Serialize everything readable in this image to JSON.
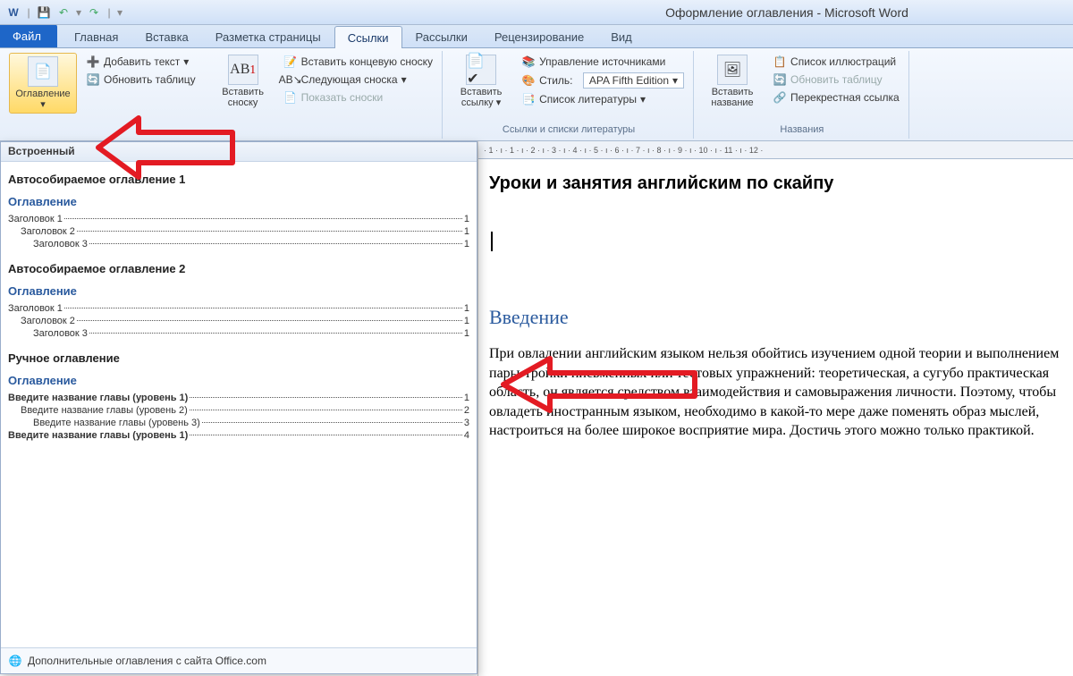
{
  "window": {
    "title": "Оформление оглавления - Microsoft Word"
  },
  "qat": {
    "save": "💾",
    "undo": "↶",
    "redo": "↷"
  },
  "tabs": {
    "file": "Файл",
    "home": "Главная",
    "insert": "Вставка",
    "layout": "Разметка страницы",
    "references": "Ссылки",
    "mailings": "Рассылки",
    "review": "Рецензирование",
    "view": "Вид"
  },
  "ribbon": {
    "toc": {
      "label": "Оглавление",
      "drop": "▾"
    },
    "add_text": "Добавить текст",
    "update_table": "Обновить таблицу",
    "insert_footnote": "Вставить сноску",
    "ab": "AB",
    "insert_endnote": "Вставить концевую сноску",
    "next_footnote": "Следующая сноска",
    "show_footnotes": "Показать сноски",
    "insert_citation": "Вставить ссылку",
    "manage_sources": "Управление источниками",
    "style_label": "Стиль:",
    "style_value": "APA Fifth Edition",
    "bibliography": "Список литературы",
    "group_citations": "Ссылки и списки литературы",
    "insert_caption": "Вставить название",
    "list_of_figures": "Список иллюстраций",
    "update_table2": "Обновить таблицу",
    "cross_reference": "Перекрестная ссылка",
    "group_captions": "Названия"
  },
  "dropdown": {
    "header": "Встроенный",
    "auto1": "Автособираемое оглавление 1",
    "auto2": "Автособираемое оглавление 2",
    "manual": "Ручное оглавление",
    "preview_title": "Оглавление",
    "h1": "Заголовок 1",
    "h2": "Заголовок 2",
    "h3": "Заголовок 3",
    "m1": "Введите название главы (уровень 1)",
    "m2": "Введите название главы (уровень 2)",
    "m3": "Введите название главы (уровень 3)",
    "m4": "Введите название главы (уровень 1)",
    "pg1": "1",
    "pg2": "2",
    "pg3": "3",
    "pg4": "4",
    "footer_more": "Дополнительные оглавления с сайта Office.com"
  },
  "ruler": " · 1 · ı · 1 · ı · 2 · ı · 3 · ı · 4 · ı · 5 · ı · 6 · ı · 7 · ı · 8 · ı · 9 · ı · 10 · ı · 11 · ı · 12 ·",
  "doc": {
    "title": "Уроки и занятия английским по скайпу",
    "heading": "Введение",
    "body": "При овладении английским языком нельзя обойтись изучением одной теории и выполнением пары-тройки письменных или тестовых упражнений: теоретическая, а сугубо практическая область, он является средством взаимодействия и самовыражения личности. Поэтому, чтобы овладеть иностранным языком, необходимо в какой-то мере даже поменять образ мыслей, настроиться на более широкое восприятие мира. Достичь этого можно только практикой."
  }
}
